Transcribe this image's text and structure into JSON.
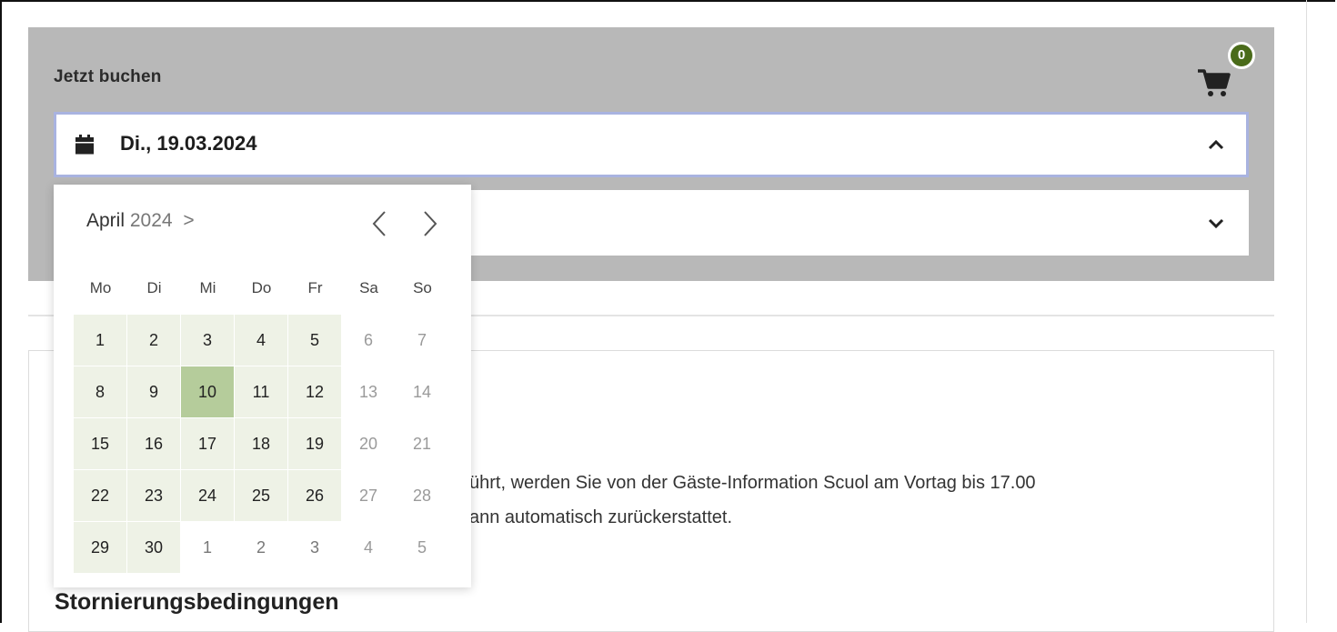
{
  "booking": {
    "title": "Jetzt buchen",
    "cart_count": "0",
    "selected_date": "Di., 19.03.2024"
  },
  "calendar": {
    "month": "April",
    "year": "2024",
    "caret": ">",
    "weekdays": [
      "Mo",
      "Di",
      "Mi",
      "Do",
      "Fr",
      "Sa",
      "So"
    ],
    "weeks": [
      [
        {
          "d": "1",
          "s": "avail"
        },
        {
          "d": "2",
          "s": "avail"
        },
        {
          "d": "3",
          "s": "avail"
        },
        {
          "d": "4",
          "s": "avail"
        },
        {
          "d": "5",
          "s": "avail"
        },
        {
          "d": "6",
          "s": "muted"
        },
        {
          "d": "7",
          "s": "muted"
        }
      ],
      [
        {
          "d": "8",
          "s": "avail"
        },
        {
          "d": "9",
          "s": "avail"
        },
        {
          "d": "10",
          "s": "selected"
        },
        {
          "d": "11",
          "s": "avail"
        },
        {
          "d": "12",
          "s": "avail"
        },
        {
          "d": "13",
          "s": "muted"
        },
        {
          "d": "14",
          "s": "muted"
        }
      ],
      [
        {
          "d": "15",
          "s": "avail"
        },
        {
          "d": "16",
          "s": "avail"
        },
        {
          "d": "17",
          "s": "avail"
        },
        {
          "d": "18",
          "s": "avail"
        },
        {
          "d": "19",
          "s": "avail"
        },
        {
          "d": "20",
          "s": "muted"
        },
        {
          "d": "21",
          "s": "muted"
        }
      ],
      [
        {
          "d": "22",
          "s": "avail"
        },
        {
          "d": "23",
          "s": "avail"
        },
        {
          "d": "24",
          "s": "avail"
        },
        {
          "d": "25",
          "s": "avail"
        },
        {
          "d": "26",
          "s": "avail"
        },
        {
          "d": "27",
          "s": "muted"
        },
        {
          "d": "28",
          "s": "muted"
        }
      ],
      [
        {
          "d": "29",
          "s": "avail"
        },
        {
          "d": "30",
          "s": "avail"
        },
        {
          "d": "1",
          "s": "outside"
        },
        {
          "d": "2",
          "s": "outside"
        },
        {
          "d": "3",
          "s": "outside"
        },
        {
          "d": "4",
          "s": "muted"
        },
        {
          "d": "5",
          "s": "muted"
        }
      ]
    ]
  },
  "info": {
    "line1": "ührt, werden Sie von der Gäste-Information Scuol am Vortag bis 17.00",
    "line2": "ann automatisch zurückerstattet.",
    "heading": "Stornierungsbedingungen"
  },
  "colors": {
    "panel_bg": "#b8b8b8",
    "field_focus_border": "#a9b3e0",
    "badge": "#4a6b1a",
    "available_day": "#eef2e6",
    "selected_day": "#b5cc9b"
  }
}
